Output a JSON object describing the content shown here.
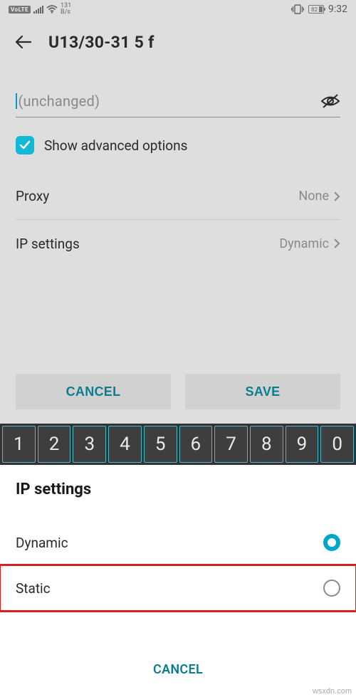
{
  "status": {
    "volte": "VoLTE",
    "net_top": "131",
    "net_bot": "B/s",
    "battery_pct": "82",
    "time": "9:32"
  },
  "header": {
    "title": "U13/30-31 5 f"
  },
  "password_field": {
    "placeholder": "(unchanged)"
  },
  "advanced_checkbox": {
    "label": "Show advanced options",
    "checked": true
  },
  "rows": {
    "proxy": {
      "label": "Proxy",
      "value": "None"
    },
    "ip": {
      "label": "IP settings",
      "value": "Dynamic"
    }
  },
  "actions": {
    "cancel": "CANCEL",
    "save": "SAVE"
  },
  "keyboard": {
    "keys": [
      "1",
      "2",
      "3",
      "4",
      "5",
      "6",
      "7",
      "8",
      "9",
      "0"
    ]
  },
  "sheet": {
    "title": "IP settings",
    "options": {
      "dynamic": "Dynamic",
      "static": "Static"
    },
    "selected": "dynamic",
    "cancel": "CANCEL"
  },
  "watermark": "wsxdn.com"
}
